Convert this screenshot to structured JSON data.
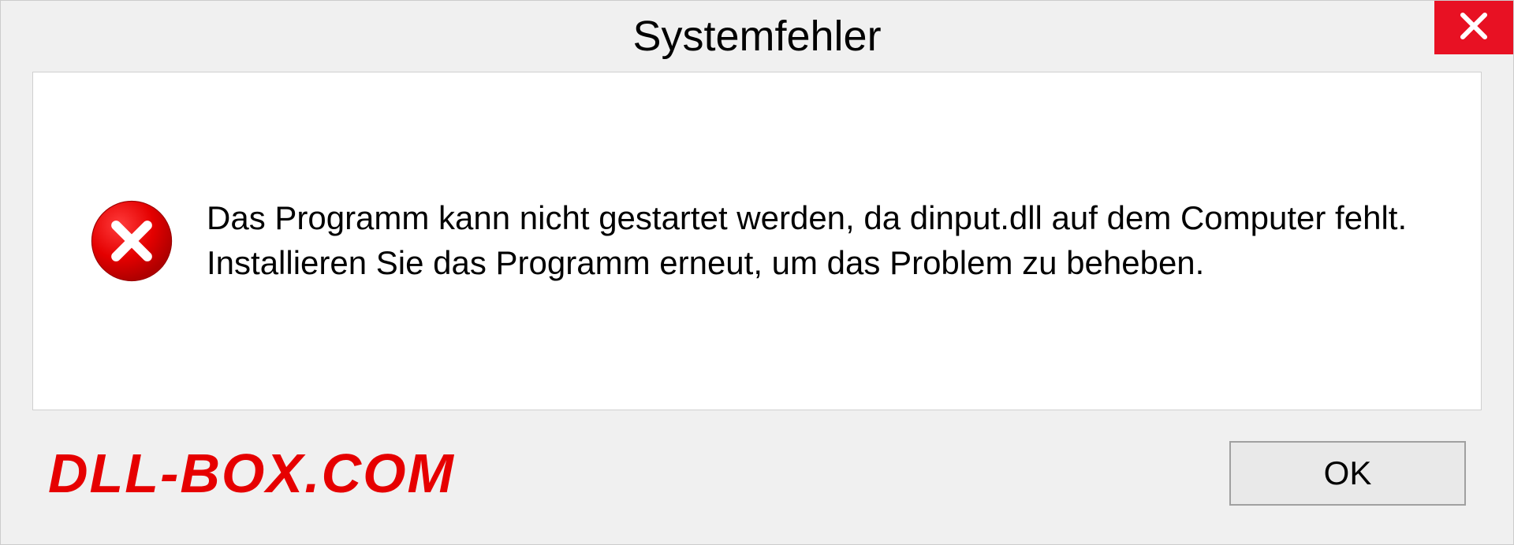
{
  "dialog": {
    "title": "Systemfehler",
    "message": "Das Programm kann nicht gestartet werden, da dinput.dll auf dem Computer fehlt. Installieren Sie das Programm erneut, um das Problem zu beheben.",
    "ok_label": "OK"
  },
  "watermark": "DLL-BOX.COM"
}
